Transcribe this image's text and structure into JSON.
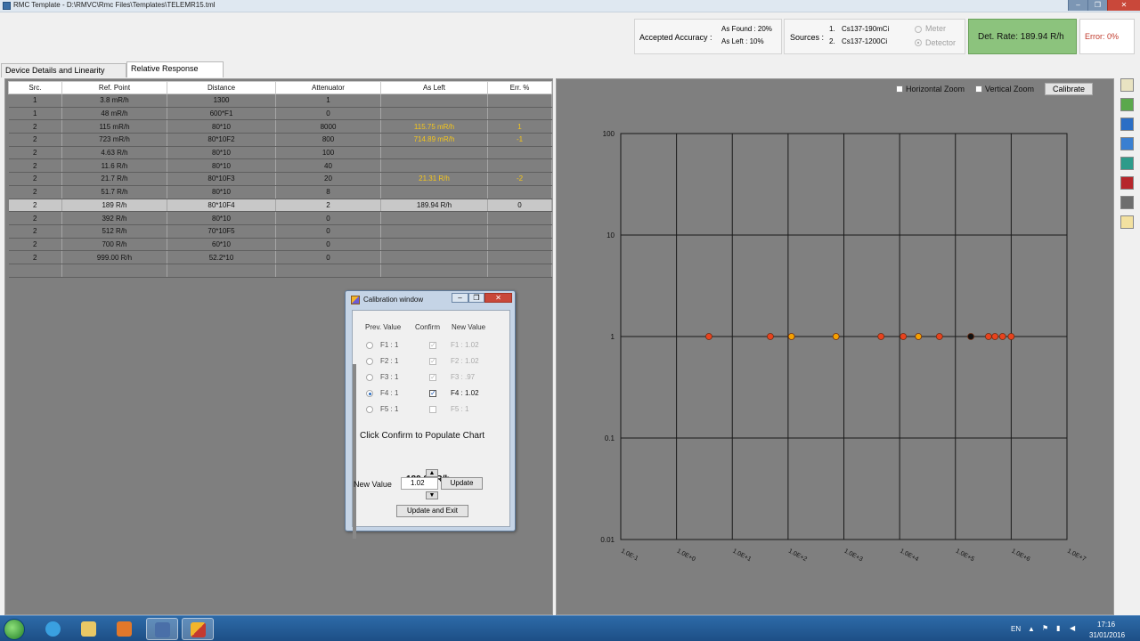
{
  "window": {
    "title": "RMC Template - D:\\RMVC\\Rmc Files\\Templates\\TELEMR15.tml",
    "min": "–",
    "max": "❐",
    "close": "✕"
  },
  "header": {
    "accuracy_label": "Accepted Accuracy :",
    "as_found": "As Found : 20%",
    "as_left": "As Left : 10%",
    "sources_label": "Sources :",
    "source_1_num": "1.",
    "source_1": "Cs137-190mCi",
    "source_2_num": "2.",
    "source_2": "Cs137-1200Ci",
    "meter_label": "Meter",
    "detector_label": "Detector",
    "det_rate": "Det. Rate: 189.94 R/h",
    "error": "Error: 0%"
  },
  "tabs": [
    {
      "label": "Device Details and Linearity Chart"
    },
    {
      "label": "Relative Response Chart"
    }
  ],
  "table": {
    "headers": [
      "Src.",
      "Ref. Point",
      "Distance",
      "Attenuator",
      "As Left",
      "Err. %"
    ],
    "rows": [
      [
        "1",
        "3.8 mR/h",
        "1300",
        "1",
        "",
        ""
      ],
      [
        "1",
        "48 mR/h",
        "600*F1",
        "0",
        "",
        ""
      ],
      [
        "2",
        "115 mR/h",
        "80*10",
        "8000",
        "115.75 mR/h",
        "1"
      ],
      [
        "2",
        "723 mR/h",
        "80*10F2",
        "800",
        "714.89 mR/h",
        "-1"
      ],
      [
        "2",
        "4.63 R/h",
        "80*10",
        "100",
        "",
        ""
      ],
      [
        "2",
        "11.6 R/h",
        "80*10",
        "40",
        "",
        ""
      ],
      [
        "2",
        "21.7 R/h",
        "80*10F3",
        "20",
        "21.31 R/h",
        "-2"
      ],
      [
        "2",
        "51.7 R/h",
        "80*10",
        "8",
        "",
        ""
      ],
      [
        "2",
        "189 R/h",
        "80*10F4",
        "2",
        "189.94 R/h",
        "0"
      ],
      [
        "2",
        "392 R/h",
        "80*10",
        "0",
        "",
        ""
      ],
      [
        "2",
        "512 R/h",
        "70*10F5",
        "0",
        "",
        ""
      ],
      [
        "2",
        "700 R/h",
        "60*10",
        "0",
        "",
        ""
      ],
      [
        "2",
        "999.00 R/h",
        "52.2*10",
        "0",
        "",
        ""
      ],
      [
        "",
        "",
        "",
        "",
        "",
        ""
      ]
    ]
  },
  "chart_controls": {
    "horizontal_zoom": "Horizontal Zoom",
    "vertical_zoom": "Vertical Zoom",
    "calibrate": "Calibrate"
  },
  "chart_data": {
    "type": "scatter",
    "x_scale": "log",
    "y_scale": "log",
    "xlim": [
      0.1,
      10000000
    ],
    "ylim": [
      0.01,
      100
    ],
    "x_ticks": [
      "1.0E-1",
      "1.0E+0",
      "1.0E+1",
      "1.0E+2",
      "1.0E+3",
      "1.0E+4",
      "1.0E+5",
      "1.0E+6",
      "1.0E+7"
    ],
    "y_ticks": [
      "100",
      "10",
      "1",
      "0.1",
      "0.01"
    ],
    "grid": true,
    "points": [
      {
        "x": 3.8,
        "y": 1,
        "color": "#e8431e"
      },
      {
        "x": 48,
        "y": 1,
        "color": "#e8431e"
      },
      {
        "x": 115,
        "y": 1,
        "color": "#f5a100"
      },
      {
        "x": 723,
        "y": 1,
        "color": "#f5a100"
      },
      {
        "x": 4630,
        "y": 1,
        "color": "#e8431e"
      },
      {
        "x": 11600,
        "y": 1,
        "color": "#e8431e"
      },
      {
        "x": 21700,
        "y": 1,
        "color": "#f5a100"
      },
      {
        "x": 51700,
        "y": 1,
        "color": "#e8431e"
      },
      {
        "x": 189000,
        "y": 1,
        "color": "#111111"
      },
      {
        "x": 392000,
        "y": 1,
        "color": "#e8431e"
      },
      {
        "x": 512000,
        "y": 1,
        "color": "#e8431e"
      },
      {
        "x": 700000,
        "y": 1,
        "color": "#e8431e"
      },
      {
        "x": 999000,
        "y": 1,
        "color": "#e8431e"
      }
    ]
  },
  "dialog": {
    "title": "Calibration window",
    "col_prev": "Prev. Value",
    "col_confirm": "Confirm",
    "col_new": "New Value",
    "rows": [
      {
        "prev": "F1 : 1",
        "check": "✓",
        "new": "F1 : 1.02"
      },
      {
        "prev": "F2 : 1",
        "check": "✓",
        "new": "F2 : 1.02"
      },
      {
        "prev": "F3 : 1",
        "check": "✓",
        "new": "F3 : .97"
      },
      {
        "prev": "F4 : 1",
        "check": "✓",
        "new": "F4 : 1.02"
      },
      {
        "prev": "F5 : 1",
        "check": "",
        "new": "F5 : 1"
      }
    ],
    "selected_row": 3,
    "instruction": "Click Confirm to Populate Chart",
    "value": "189.94 R/h",
    "new_value_label": "New Value",
    "new_value": "1.02",
    "update": "Update",
    "update_exit": "Update and Exit",
    "up_arrow": "▲",
    "down_arrow": "▼"
  },
  "taskbar": {
    "lang": "EN",
    "time": "17:16",
    "date": "31/01/2016"
  }
}
